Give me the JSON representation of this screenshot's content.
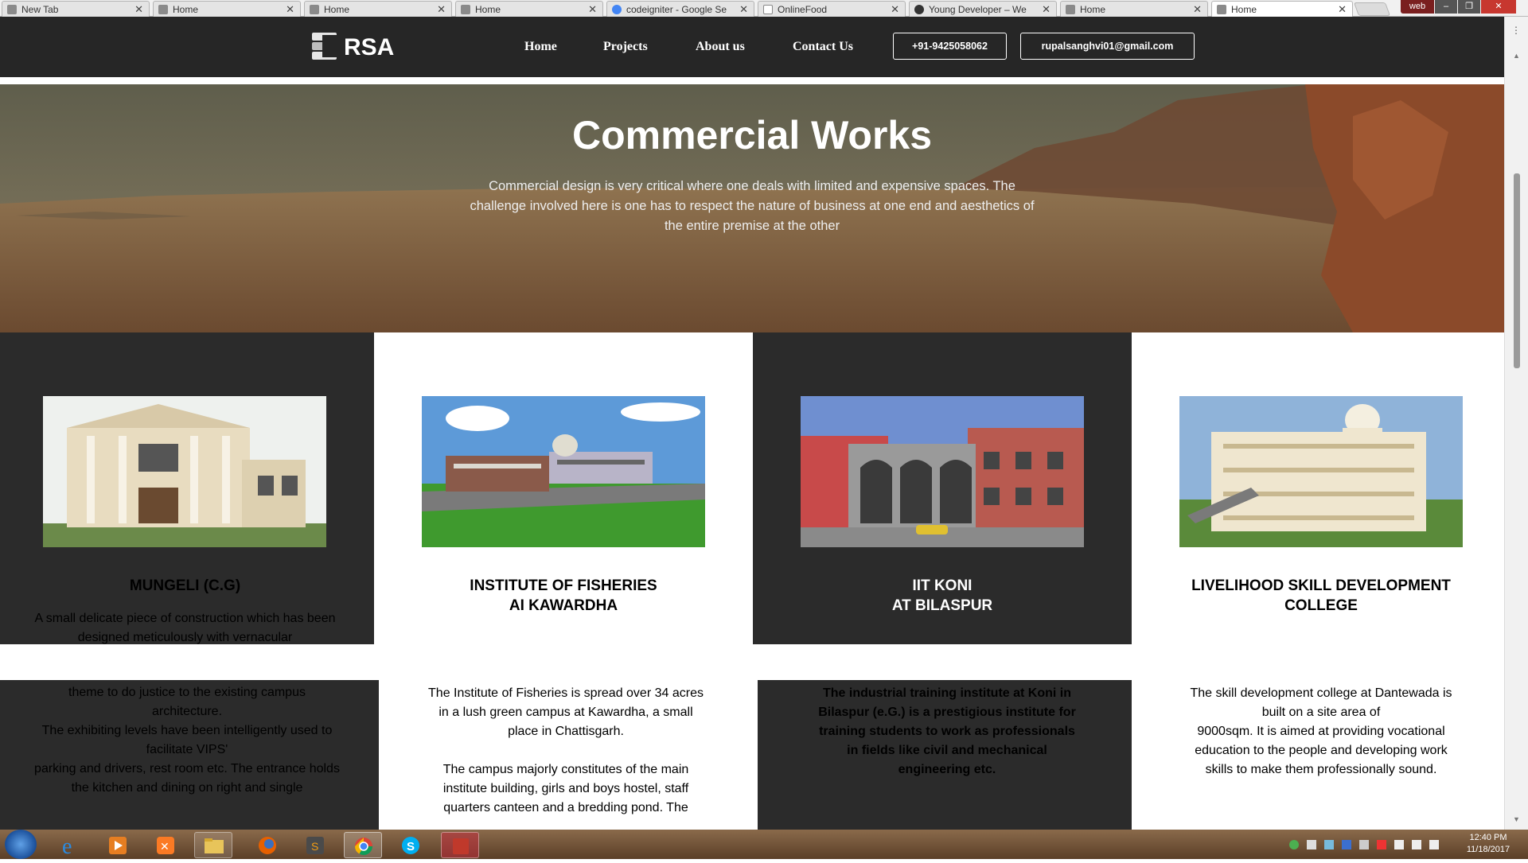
{
  "browser": {
    "tabs": [
      {
        "label": "New Tab",
        "active": false
      },
      {
        "label": "Home",
        "active": false
      },
      {
        "label": "Home",
        "active": false
      },
      {
        "label": "Home",
        "active": false
      },
      {
        "label": "codeigniter - Google Se",
        "active": false
      },
      {
        "label": "OnlineFood",
        "active": false
      },
      {
        "label": "Young Developer – We",
        "active": false
      },
      {
        "label": "Home",
        "active": false
      },
      {
        "label": "Home",
        "active": true
      }
    ],
    "profile_label": "web"
  },
  "site": {
    "logo": "RSA",
    "nav": [
      "Home",
      "Projects",
      "About us",
      "Contact Us"
    ],
    "phone": "+91-9425058062",
    "email": "rupalsanghvi01@gmail.com"
  },
  "hero": {
    "title": "Commercial Works",
    "description": "Commercial design is very critical where one deals with limited and expensive spaces. The challenge involved here is one has to respect the nature of business at one end and aesthetics of the entire premise at the other"
  },
  "cards": [
    {
      "title": "MUNGELI (C.G)",
      "intro": "A small delicate piece of construction which has been designed meticulously with vernacular",
      "body": "theme to do justice to the existing campus architecture.\nThe exhibiting levels have been intelligently used to facilitate VIPS'\nparking and drivers, rest room etc. The entrance holds the kitchen and dining on right and single"
    },
    {
      "title": "INSTITUTE OF FISHERIES\nAI KAWARDHA",
      "body": "The Institute of Fisheries is spread over 34 acres in a lush green campus at Kawardha, a small place in Chattisgarh.\n\nThe campus majorly constitutes of the main institute building, girls and boys hostel, staff quarters canteen and a bredding pond. The"
    },
    {
      "title": "IIT KONI\nAT BILASPUR",
      "body": "The industrial training institute at Koni in Bilaspur (e.G.) is a prestigious institute for training students to work as professionals in fields like civil and mechanical engineering etc."
    },
    {
      "title": "LIVELIHOOD SKILL DEVELOPMENT COLLEGE",
      "body": "The skill development college at Dantewada is built on a site area of\n9000sqm. It is aimed at providing vocational education to the people and developing work skills to make them professionally sound."
    }
  ],
  "taskbar": {
    "time": "12:40 PM",
    "date": "11/18/2017"
  }
}
